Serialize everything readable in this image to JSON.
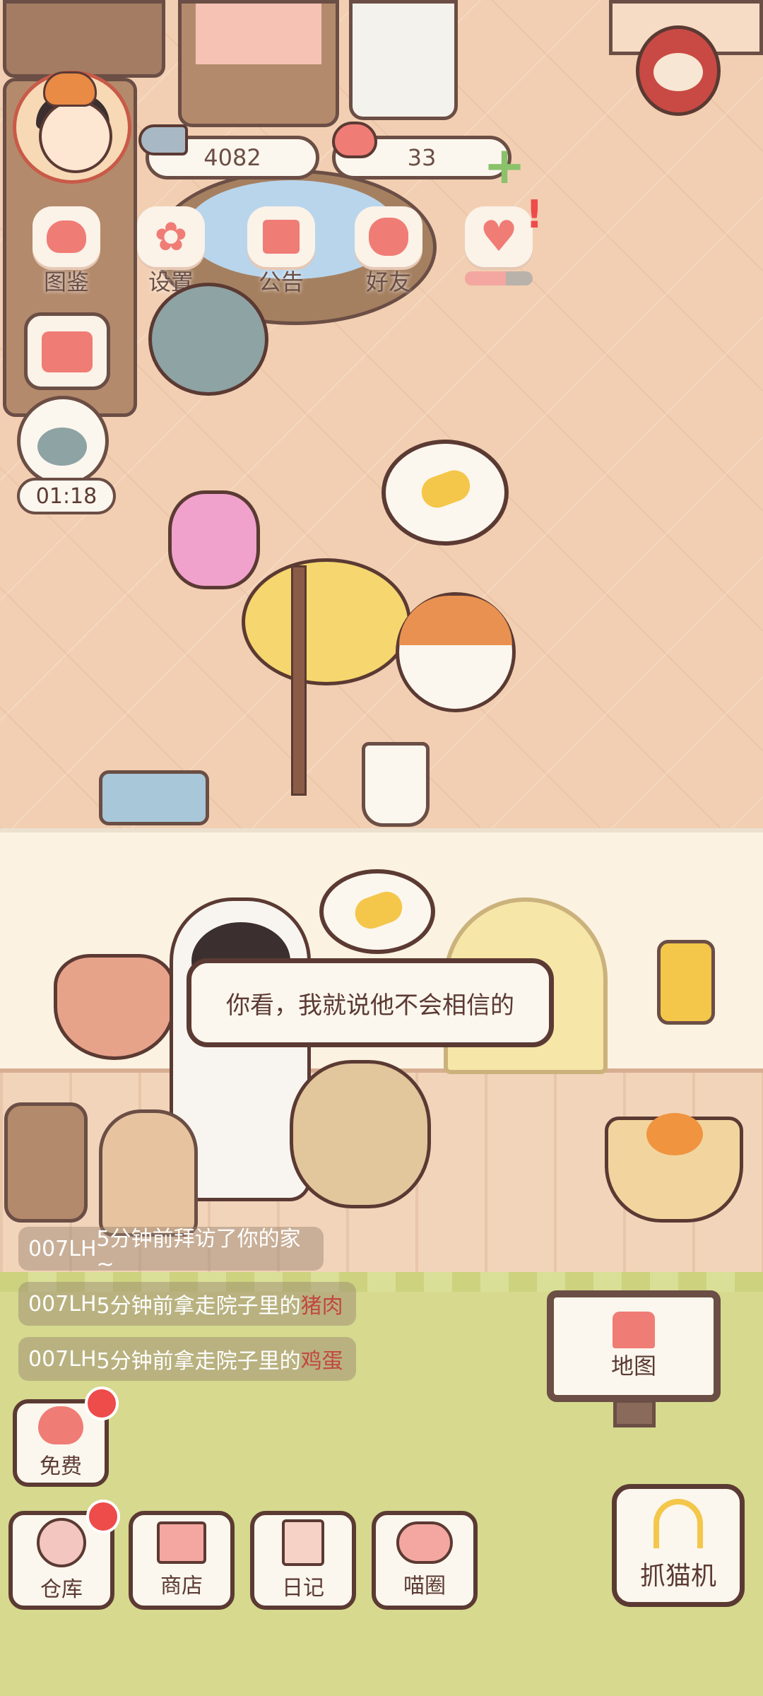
{
  "hud": {
    "fish_count": "4082",
    "heart_count": "33"
  },
  "menu": [
    {
      "label": "图鉴",
      "icon": "cat-book-icon"
    },
    {
      "label": "设置",
      "icon": "gear-icon"
    },
    {
      "label": "公告",
      "icon": "gift-icon"
    },
    {
      "label": "好友",
      "icon": "friends-icon"
    },
    {
      "label": "",
      "icon": "heart-icon"
    }
  ],
  "timer": "01:18",
  "dialog": "你看，我就说他不会相信的",
  "feed": [
    {
      "name": "007LH",
      "text": "5分钟前拜访了你的家~",
      "item": ""
    },
    {
      "name": "007LH",
      "text": "5分钟前拿走院子里的",
      "item": "猪肉"
    },
    {
      "name": "007LH",
      "text": "5分钟前拿走院子里的",
      "item": "鸡蛋"
    }
  ],
  "buttons": {
    "free": "免费",
    "warehouse": "仓库",
    "shop": "商店",
    "diary": "日记",
    "circle": "喵圈",
    "map": "地图",
    "claw": "抓猫机"
  },
  "colors": {
    "accent": "#ee4b4b",
    "outline": "#5b3a33",
    "floor": "#f2cfb2",
    "grass": "#d6d98e"
  }
}
